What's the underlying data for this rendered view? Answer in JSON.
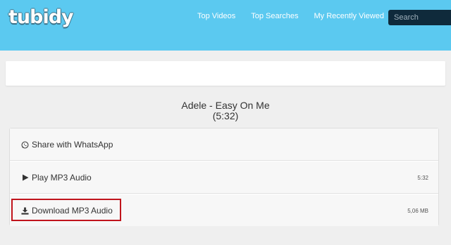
{
  "header": {
    "logo_text": "tubidy",
    "nav": [
      "Top Videos",
      "Top Searches",
      "My Recently Viewed"
    ],
    "search_placeholder": "Search"
  },
  "track": {
    "title": "Adele - Easy On Me",
    "duration": "(5:32)"
  },
  "actions": {
    "share_label": "Share with WhatsApp",
    "play_label": "Play MP3 Audio",
    "play_duration": "5:32",
    "download_label": "Download MP3 Audio",
    "download_size": "5,06 MB"
  },
  "colors": {
    "header_bg": "#5bc9f0",
    "highlight": "#c0141c"
  },
  "icons": {
    "share": "whatsapp-icon",
    "play": "play-icon",
    "download": "download-icon"
  }
}
